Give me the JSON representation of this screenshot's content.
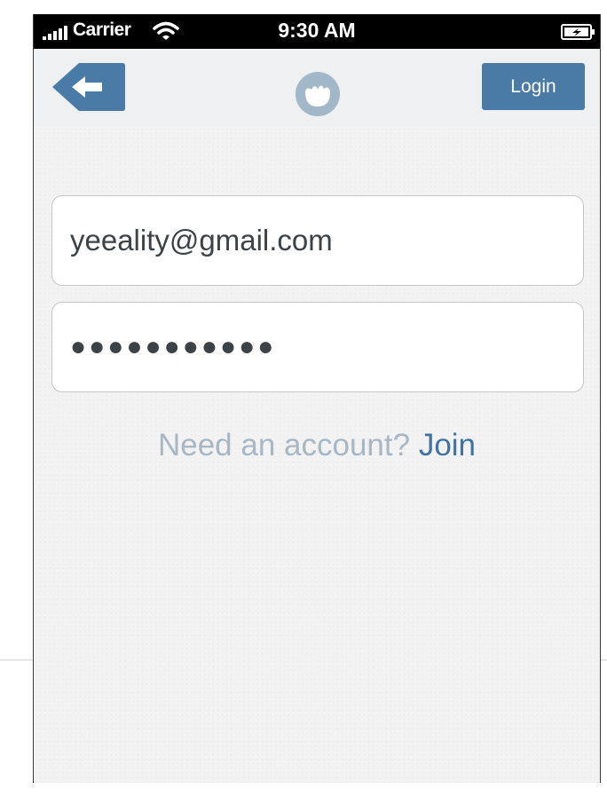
{
  "status_bar": {
    "carrier": "Carrier",
    "time": "9:30 AM",
    "icons": [
      "signal-bars-icon",
      "wifi-icon",
      "battery-charging-icon"
    ]
  },
  "nav_bar": {
    "back_icon": "back-arrow-icon",
    "logo_icon": "app-logo-icon",
    "login_label": "Login"
  },
  "form": {
    "email_value": "yeeality@gmail.com",
    "password_value": "●●●●●●●●●●●"
  },
  "footer": {
    "prompt_text": "Need an account?",
    "join_label": "Join"
  },
  "colors": {
    "accent": "#4a7ba7",
    "link": "#3e73a4",
    "prompt": "#a8b7c4",
    "nav_background": "#eef0f1",
    "status_bar_background": "#000000"
  }
}
